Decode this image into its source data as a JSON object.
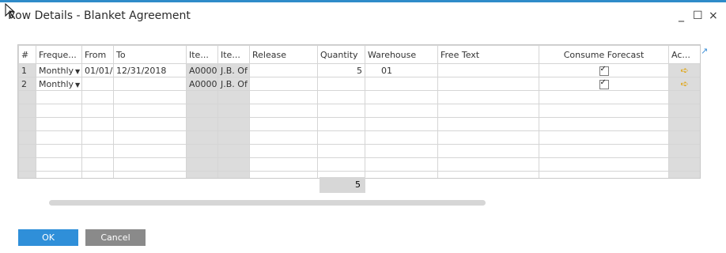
{
  "window": {
    "title": "Row Details - Blanket Agreement",
    "controls": {
      "minimize": "_",
      "maximize": "☐",
      "close": "×"
    }
  },
  "table": {
    "headers": [
      "#",
      "Freque...",
      "From",
      "To",
      "Ite...",
      "Ite...",
      "Release",
      "Quantity",
      "Warehouse",
      "Free Text",
      "Consume Forecast",
      "Ac..."
    ],
    "rows": [
      {
        "num": "1",
        "frequency": "Monthly",
        "from": "01/01/",
        "to": "12/31/2018",
        "item_no": "A0000",
        "item_desc": "J.B. Of",
        "release": "",
        "quantity": "5",
        "warehouse": "01",
        "free_text": "",
        "consume_forecast": true,
        "action": "arrow-right"
      },
      {
        "num": "2",
        "frequency": "Monthly",
        "from": "",
        "to": "",
        "item_no": "A0000",
        "item_desc": "J.B. Of",
        "release": "",
        "quantity": "",
        "warehouse": "",
        "free_text": "",
        "consume_forecast": true,
        "action": "arrow-right"
      }
    ],
    "total_quantity": "5"
  },
  "buttons": {
    "ok": "OK",
    "cancel": "Cancel"
  },
  "colors": {
    "accent": "#2f8fd9",
    "cancel": "#8a8a8a",
    "gray_col": "#dcdcdc",
    "arrow": "#e0a000"
  }
}
